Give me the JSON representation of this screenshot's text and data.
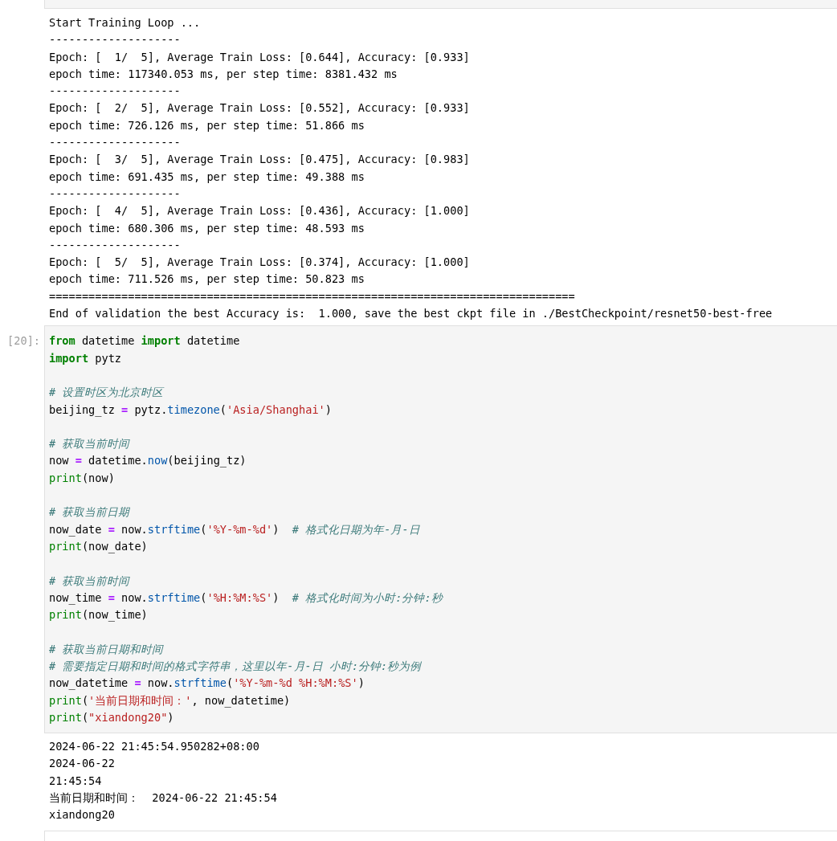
{
  "previous_output": {
    "lines": [
      "Start Training Loop ...",
      "--------------------",
      "Epoch: [  1/  5], Average Train Loss: [0.644], Accuracy: [0.933]",
      "epoch time: 117340.053 ms, per step time: 8381.432 ms",
      "--------------------",
      "Epoch: [  2/  5], Average Train Loss: [0.552], Accuracy: [0.933]",
      "epoch time: 726.126 ms, per step time: 51.866 ms",
      "--------------------",
      "Epoch: [  3/  5], Average Train Loss: [0.475], Accuracy: [0.983]",
      "epoch time: 691.435 ms, per step time: 49.388 ms",
      "--------------------",
      "Epoch: [  4/  5], Average Train Loss: [0.436], Accuracy: [1.000]",
      "epoch time: 680.306 ms, per step time: 48.593 ms",
      "--------------------",
      "Epoch: [  5/  5], Average Train Loss: [0.374], Accuracy: [1.000]",
      "epoch time: 711.526 ms, per step time: 50.823 ms",
      "================================================================================",
      "End of validation the best Accuracy is:  1.000, save the best ckpt file in ./BestCheckpoint/resnet50-best-free"
    ]
  },
  "cell": {
    "prompt": "[20]:",
    "blocks": [
      [
        [
          {
            "kind": "kw",
            "text": "from"
          },
          {
            "kind": "name",
            "text": " datetime "
          },
          {
            "kind": "kw",
            "text": "import"
          },
          {
            "kind": "name",
            "text": " datetime"
          }
        ],
        [
          {
            "kind": "kw",
            "text": "import"
          },
          {
            "kind": "name",
            "text": " pytz"
          }
        ]
      ],
      [
        [
          {
            "kind": "comment",
            "text": "# 设置时区为北京时区"
          }
        ],
        [
          {
            "kind": "name",
            "text": "beijing_tz "
          },
          {
            "kind": "op",
            "text": "="
          },
          {
            "kind": "name",
            "text": " pytz."
          },
          {
            "kind": "func",
            "text": "timezone"
          },
          {
            "kind": "name",
            "text": "("
          },
          {
            "kind": "str",
            "text": "'Asia/Shanghai'"
          },
          {
            "kind": "name",
            "text": ")"
          }
        ]
      ],
      [
        [
          {
            "kind": "comment",
            "text": "# 获取当前时间"
          }
        ],
        [
          {
            "kind": "name",
            "text": "now "
          },
          {
            "kind": "op",
            "text": "="
          },
          {
            "kind": "name",
            "text": " datetime."
          },
          {
            "kind": "func",
            "text": "now"
          },
          {
            "kind": "name",
            "text": "(beijing_tz)"
          }
        ],
        [
          {
            "kind": "builtin",
            "text": "print"
          },
          {
            "kind": "name",
            "text": "(now)"
          }
        ]
      ],
      [
        [
          {
            "kind": "comment",
            "text": "# 获取当前日期"
          }
        ],
        [
          {
            "kind": "name",
            "text": "now_date "
          },
          {
            "kind": "op",
            "text": "="
          },
          {
            "kind": "name",
            "text": " now."
          },
          {
            "kind": "func",
            "text": "strftime"
          },
          {
            "kind": "name",
            "text": "("
          },
          {
            "kind": "str",
            "text": "'%Y-%m-%d'"
          },
          {
            "kind": "name",
            "text": ")  "
          },
          {
            "kind": "comment",
            "text": "# 格式化日期为年-月-日"
          }
        ],
        [
          {
            "kind": "builtin",
            "text": "print"
          },
          {
            "kind": "name",
            "text": "(now_date)"
          }
        ]
      ],
      [
        [
          {
            "kind": "comment",
            "text": "# 获取当前时间"
          }
        ],
        [
          {
            "kind": "name",
            "text": "now_time "
          },
          {
            "kind": "op",
            "text": "="
          },
          {
            "kind": "name",
            "text": " now."
          },
          {
            "kind": "func",
            "text": "strftime"
          },
          {
            "kind": "name",
            "text": "("
          },
          {
            "kind": "str",
            "text": "'%H:%M:%S'"
          },
          {
            "kind": "name",
            "text": ")  "
          },
          {
            "kind": "comment",
            "text": "# 格式化时间为小时:分钟:秒"
          }
        ],
        [
          {
            "kind": "builtin",
            "text": "print"
          },
          {
            "kind": "name",
            "text": "(now_time)"
          }
        ]
      ],
      [
        [
          {
            "kind": "comment",
            "text": "# 获取当前日期和时间"
          }
        ],
        [
          {
            "kind": "comment",
            "text": "# 需要指定日期和时间的格式字符串，这里以年-月-日 小时:分钟:秒为例"
          }
        ],
        [
          {
            "kind": "name",
            "text": "now_datetime "
          },
          {
            "kind": "op",
            "text": "="
          },
          {
            "kind": "name",
            "text": " now."
          },
          {
            "kind": "func",
            "text": "strftime"
          },
          {
            "kind": "name",
            "text": "("
          },
          {
            "kind": "str",
            "text": "'%Y-%m-%d %H:%M:%S'"
          },
          {
            "kind": "name",
            "text": ")"
          }
        ],
        [
          {
            "kind": "builtin",
            "text": "print"
          },
          {
            "kind": "name",
            "text": "("
          },
          {
            "kind": "str",
            "text": "'当前日期和时间：'"
          },
          {
            "kind": "name",
            "text": ", now_datetime)"
          }
        ],
        [
          {
            "kind": "builtin",
            "text": "print"
          },
          {
            "kind": "name",
            "text": "("
          },
          {
            "kind": "str",
            "text": "\"xiandong20\""
          },
          {
            "kind": "name",
            "text": ")"
          }
        ]
      ]
    ]
  },
  "output": {
    "lines": [
      "2024-06-22 21:45:54.950282+08:00",
      "2024-06-22",
      "21:45:54",
      "当前日期和时间：  2024-06-22 21:45:54",
      "xiandong20"
    ]
  }
}
